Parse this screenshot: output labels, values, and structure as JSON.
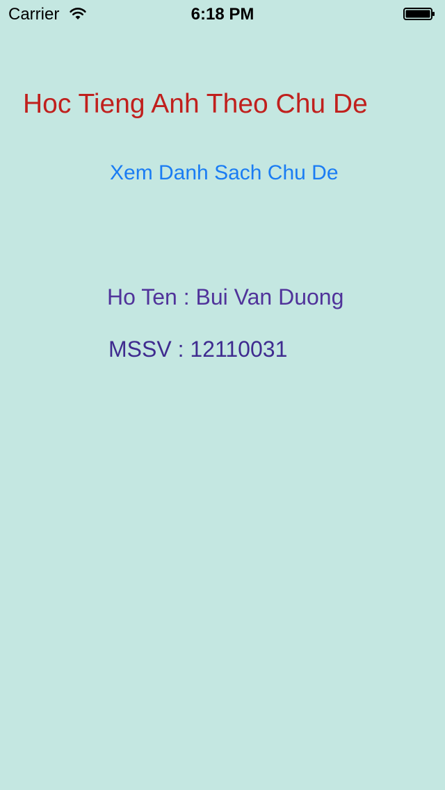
{
  "status_bar": {
    "carrier": "Carrier",
    "time": "6:18 PM",
    "wifi_icon": "wifi-icon",
    "battery_icon": "battery-full-icon"
  },
  "main": {
    "title": "Hoc Tieng Anh Theo Chu De",
    "topics_link_label": "Xem Danh Sach Chu De",
    "student_name": "Ho Ten : Bui Van Duong",
    "student_id": "MSSV : 12110031"
  },
  "colors": {
    "background": "#c4e7e1",
    "title": "#c0201d",
    "link": "#1a7cf3",
    "name_text": "#50339a",
    "id_text": "#3f2b8f"
  }
}
